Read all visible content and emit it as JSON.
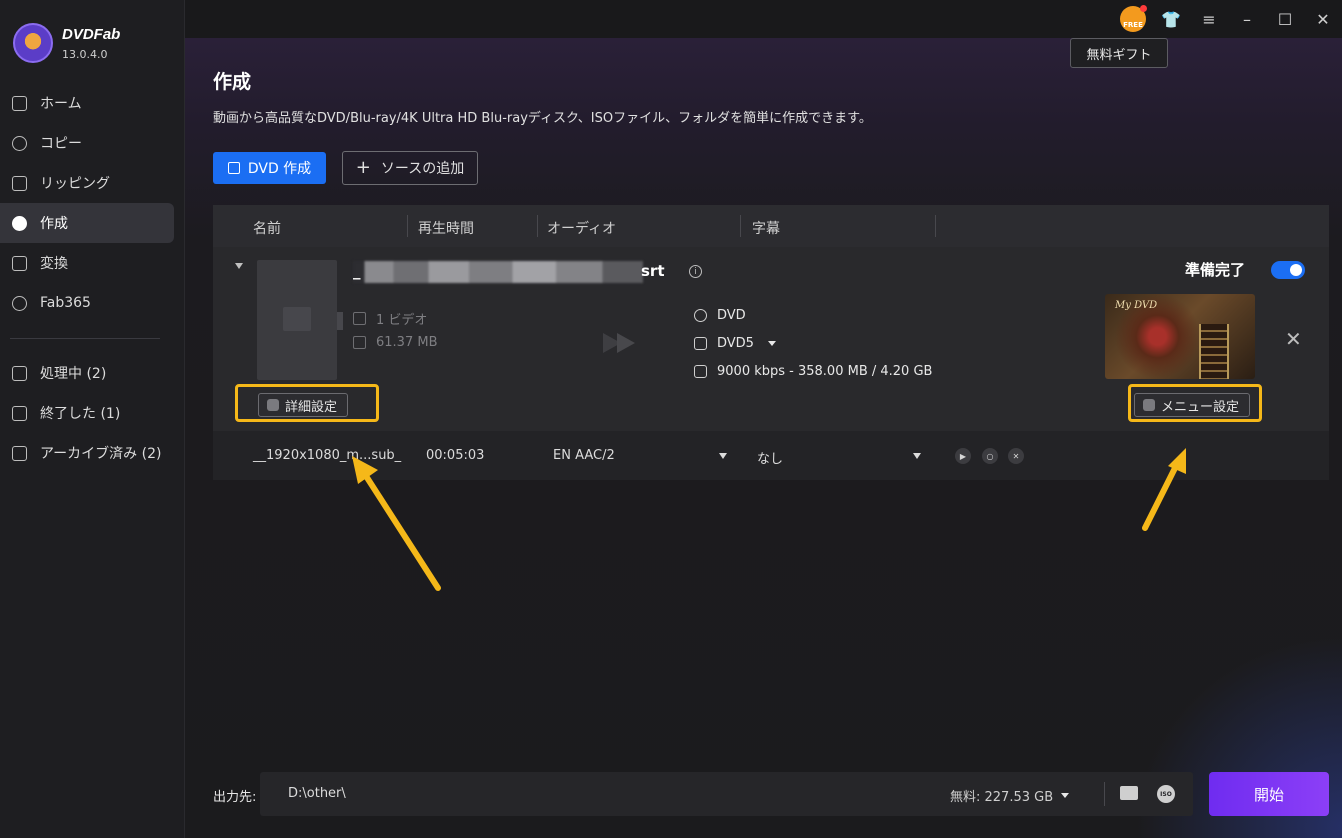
{
  "app": {
    "brand": "DVDFab",
    "version": "13.0.4.0"
  },
  "sidebar": {
    "items": [
      {
        "label": "ホーム",
        "icon": "home-icon"
      },
      {
        "label": "コピー",
        "icon": "copy-icon"
      },
      {
        "label": "リッピング",
        "icon": "ripper-icon"
      },
      {
        "label": "作成",
        "icon": "creator-icon",
        "active": true
      },
      {
        "label": "変換",
        "icon": "converter-icon"
      },
      {
        "label": "Fab365",
        "icon": "fab365-icon"
      }
    ],
    "queue": [
      {
        "label": "処理中 (2)",
        "icon": "processing-icon"
      },
      {
        "label": "終了した (1)",
        "icon": "finished-icon"
      },
      {
        "label": "アーカイブ済み (2)",
        "icon": "archive-icon"
      }
    ]
  },
  "topbar": {
    "gift_badge": "FREE",
    "tooltip": "無料ギフト"
  },
  "main": {
    "title": "作成",
    "description": "動画から高品質なDVD/Blu-ray/4K Ultra HD Blu-rayディスク、ISOファイル、フォルダを簡単に作成できます。",
    "primary_button": "DVD 作成",
    "add_source_button": "ソースの追加"
  },
  "table": {
    "headers": [
      "名前",
      "再生時間",
      "オーディオ",
      "字幕"
    ],
    "item": {
      "title_lead": "_",
      "title_tail": "srt",
      "video_count": "1 ビデオ",
      "file_size": "61.37 MB",
      "output_format": "DVD",
      "disc_type": "DVD5",
      "bitrate_info": "9000 kbps - 358.00 MB / 4.20 GB",
      "status": "準備完了",
      "ready_enabled": true,
      "menu_thumb_title": "My DVD",
      "advanced_button": "詳細設定",
      "menu_button": "メニュー設定"
    },
    "track": {
      "name": "__1920x1080_m...sub_",
      "duration": "00:05:03",
      "audio": "EN  AAC/2",
      "subtitle": "なし"
    }
  },
  "footer": {
    "output_label": "出力先:",
    "path": "D:\\other\\",
    "free_space": "無料:  227.53 GB",
    "iso_label": "ISO",
    "start_button": "開始"
  },
  "colors": {
    "accent": "#1b6ef3",
    "start": "#7b34f3",
    "highlight": "#f5b819"
  }
}
